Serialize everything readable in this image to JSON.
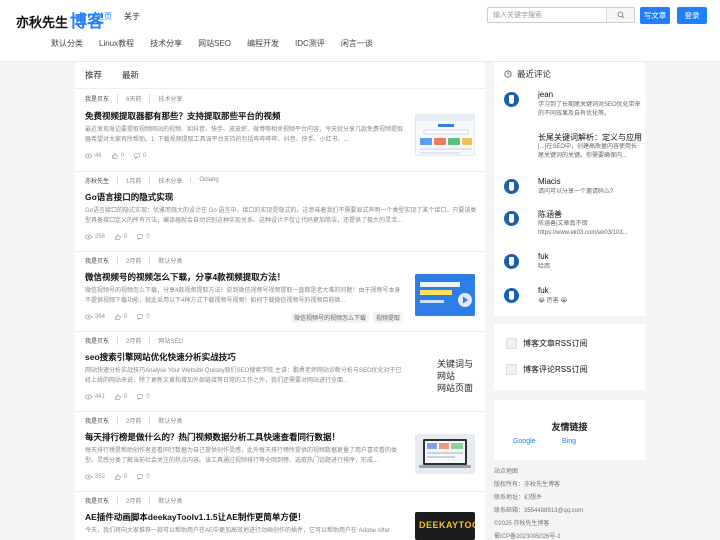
{
  "header": {
    "logo_text": "亦秋先生",
    "logo_accent": "博客",
    "nav": [
      "首页",
      "关于"
    ],
    "search_placeholder": "输入关键字搜索",
    "write_button": "写文章",
    "login_button": "登录"
  },
  "categories": [
    "默认分类",
    "Linux教程",
    "技术分享",
    "网站SEO",
    "编程开发",
    "IDC测评",
    "闲言一谈"
  ],
  "tabs": [
    "推荐",
    "最新"
  ],
  "articles": [
    {
      "author": "我是贝东",
      "time": "6天前",
      "tags": [
        "技术分享"
      ],
      "title": "免费视频提取器都有那些？支持提取那些平台的视频",
      "desc": "最近发现身边要提取视频网站的视频、如抖音、快手、皮皮虾、微博等相关视频平台内容，今天就分享几款免费视频提取器希望对大家有所帮助。1: 下载视频提取工具该平台支持的包括哔哔哔哔、抖音、快手、小红书、...",
      "views": "46",
      "likes": "0",
      "comments": "0",
      "bottom_tags": []
    },
    {
      "author": "亦秋先生",
      "time": "1月前",
      "tags": [
        "技术分享",
        "Golang"
      ],
      "title": "Go语言接口的隐式实现",
      "desc": "Go语言接口的隐式实现：优雅而强大的设计在 Go 语言中，接口的实现是隐式的。这意味着我们不需要显式声明一个类型实现了某个接口，只要该类型具备接口定义的所有方法，编译器就会自动识别这种实现关系。这种设计不仅让代码更加简洁，还提供了极大的灵活...",
      "views": "256",
      "likes": "0",
      "comments": "0",
      "bottom_tags": []
    },
    {
      "author": "我是贝东",
      "time": "2月前",
      "tags": [
        "默认分类"
      ],
      "title": "微信视频号的视频怎么下载，分享4款视频提取方法！",
      "desc": "微信视频号的视频怎么下载，分享4款视频提取方法！说到微信视频号视频提取一直都是老大难的问题！由于视频号本身不提供视频下载功能，就此采用以下4种方式下载视频号视频！如何下载微信视频号的视频目前微...",
      "views": "364",
      "likes": "0",
      "comments": "0",
      "bottom_tags": [
        "微信视频号的视频怎么下载",
        "视频提取"
      ]
    },
    {
      "author": "我是贝东",
      "time": "2月前",
      "tags": [
        "网站SEO"
      ],
      "title": "seo搜索引擎网站优化快速分析实战技巧",
      "desc": "网站快速分析实战技巧Analyse Your Website Quickly原们SEO搜索学院 主讲：鹏勇老师网站诊断分析与SEO优化对于已经上线的网站来说，除了更新文章和增加外部链接等日常的工作之外，我们还需要对网站进行全面...",
      "views": "441",
      "likes": "0",
      "comments": "0",
      "bottom_tags": []
    },
    {
      "author": "我是贝东",
      "time": "2月前",
      "tags": [
        "默认分类"
      ],
      "title": "每天排行榜是做什么的？热门视频数据分析工具快速查看同行数据！",
      "desc": "每天排行榜是帮助创作者查看同行数据为自己提供创作灵感，此外每天排行榜所提供的视频数据更量了用户喜欢看的类型。灵感分类了解当前社会关注的热点内容。该工具通过视频排行等全网到榜、选取热门话题进行排序，形成...",
      "views": "352",
      "likes": "0",
      "comments": "0",
      "bottom_tags": []
    },
    {
      "author": "我是贝东",
      "time": "2月前",
      "tags": [
        "默认分类"
      ],
      "title": "AE插件动画脚本deekayToolv1.1.5让AE制作更简单方便！",
      "desc": "今天，我们将向大家推荐一款可以帮助用户在AE中更加高效地进行动画创作的插件，它可以帮助用户在 Adobe After Effects（简称AE）插件中提...",
      "views": "",
      "likes": "",
      "comments": "",
      "bottom_tags": []
    }
  ],
  "thumb_texts": {
    "seo": [
      "关键词与",
      "网站",
      "网站页面"
    ],
    "deekay": "DEEKAYTOOL"
  },
  "sidebar": {
    "comments_title": "最近评论",
    "comments": [
      {
        "name": "jean",
        "text": "学习到了长期尾关键词对SEO优化带来的不同效果及自有优化等。"
      },
      {
        "name": "长尾关键词解析：定义与应用",
        "text": "[...]在SEO中，创建高质量内容使用长尾关键词的关键。你需要确保内..."
      },
      {
        "name": "Miacis",
        "text": "请问可以分享一个邀请码么?"
      },
      {
        "name": "陈涵善",
        "text": "陈涵善|文章真不错 https://www.ek03.com/ek03/103..."
      },
      {
        "name": "fuk",
        "text": "哈西"
      },
      {
        "name": "fuk",
        "text": "😭 厉害 😭"
      }
    ],
    "rss": [
      "博客文章RSS订阅",
      "博客评论RSS订阅"
    ],
    "friends_title": "友情链接",
    "friends": [
      "Google",
      "Bing"
    ],
    "footer": [
      "站点地图",
      "版权所有：亦秋先生博客",
      "联系地址：幻想乡",
      "联系邮箱：3554488913@qq.com",
      "©2025 亦秋先生博客",
      "蜀ICP备2023005026号-1"
    ]
  },
  "colors": {
    "accent": "#1e80ff",
    "background": "#f4f5f5"
  }
}
